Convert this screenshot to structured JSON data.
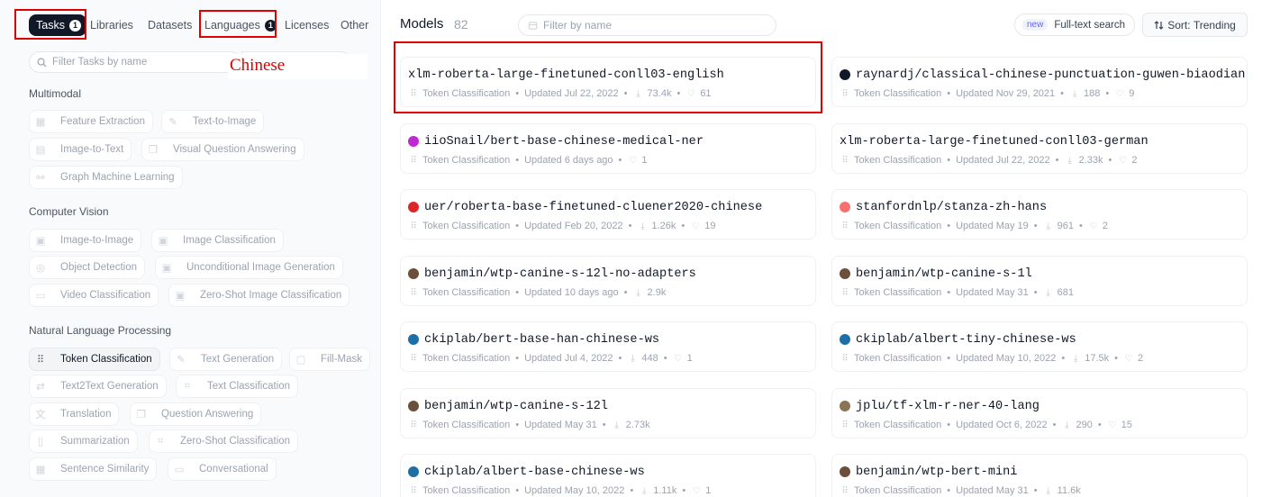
{
  "filter_tabs": [
    {
      "label": "Tasks",
      "badge": "1",
      "active": true
    },
    {
      "label": "Libraries"
    },
    {
      "label": "Datasets"
    },
    {
      "label": "Languages",
      "badge": "1"
    },
    {
      "label": "Licenses"
    },
    {
      "label": "Other"
    }
  ],
  "sidebar": {
    "search_placeholder": "Filter Tasks by name",
    "annotation": "Chinese",
    "sections": [
      {
        "title": "Multimodal",
        "chips": [
          {
            "label": "Feature Extraction",
            "icon": "table-icon"
          },
          {
            "label": "Text-to-Image",
            "icon": "brush-icon"
          },
          {
            "label": "Image-to-Text",
            "icon": "image-text-icon"
          },
          {
            "label": "Visual Question Answering",
            "icon": "qa-icon"
          },
          {
            "label": "Graph Machine Learning",
            "icon": "graph-icon"
          }
        ]
      },
      {
        "title": "Computer Vision",
        "chips": [
          {
            "label": "Image-to-Image",
            "icon": "image-icon"
          },
          {
            "label": "Image Classification",
            "icon": "image-icon"
          },
          {
            "label": "Object Detection",
            "icon": "detect-icon"
          },
          {
            "label": "Unconditional Image Generation",
            "icon": "image-icon"
          },
          {
            "label": "Video Classification",
            "icon": "video-icon"
          },
          {
            "label": "Zero-Shot Image Classification",
            "icon": "image-icon"
          }
        ]
      },
      {
        "title": "Natural Language Processing",
        "chips": [
          {
            "label": "Token Classification",
            "icon": "token-icon",
            "selected": true
          },
          {
            "label": "Text Generation",
            "icon": "pen-icon"
          },
          {
            "label": "Fill-Mask",
            "icon": "mask-icon"
          },
          {
            "label": "Text2Text Generation",
            "icon": "text2text-icon"
          },
          {
            "label": "Text Classification",
            "icon": "tags-icon"
          },
          {
            "label": "Translation",
            "icon": "translate-icon"
          },
          {
            "label": "Question Answering",
            "icon": "qa-icon"
          },
          {
            "label": "Summarization",
            "icon": "doc-icon"
          },
          {
            "label": "Zero-Shot Classification",
            "icon": "tags-icon"
          },
          {
            "label": "Sentence Similarity",
            "icon": "grid-icon"
          },
          {
            "label": "Conversational",
            "icon": "chat-icon"
          }
        ]
      }
    ]
  },
  "header": {
    "title": "Models",
    "count": "82",
    "filter_placeholder": "Filter by name",
    "fulltext_badge": "new",
    "fulltext_label": "Full-text search",
    "sort_label": "Sort:",
    "sort_value": "Trending"
  },
  "models": [
    {
      "name": "xlm-roberta-large-finetuned-conll03-english",
      "task": "Token Classification",
      "updated": "Updated Jul 22, 2022",
      "downloads": "73.4k",
      "likes": "61",
      "avatar": "none"
    },
    {
      "name": "raynardj/classical-chinese-punctuation-guwen-biaodian",
      "task": "Token Classification",
      "updated": "Updated Nov 29, 2021",
      "downloads": "188",
      "likes": "9",
      "avatar": "#111827"
    },
    {
      "name": "iioSnail/bert-base-chinese-medical-ner",
      "task": "Token Classification",
      "updated": "Updated 6 days ago",
      "downloads": "",
      "likes": "1",
      "avatar": "#c026d3"
    },
    {
      "name": "xlm-roberta-large-finetuned-conll03-german",
      "task": "Token Classification",
      "updated": "Updated Jul 22, 2022",
      "downloads": "2.33k",
      "likes": "2",
      "avatar": "none"
    },
    {
      "name": "uer/roberta-base-finetuned-cluener2020-chinese",
      "task": "Token Classification",
      "updated": "Updated Feb 20, 2022",
      "downloads": "1.26k",
      "likes": "19",
      "avatar": "#dc2626"
    },
    {
      "name": "stanfordnlp/stanza-zh-hans",
      "task": "Token Classification",
      "updated": "Updated May 19",
      "downloads": "961",
      "likes": "2",
      "avatar": "#f87171"
    },
    {
      "name": "benjamin/wtp-canine-s-12l-no-adapters",
      "task": "Token Classification",
      "updated": "Updated 10 days ago",
      "downloads": "2.9k",
      "likes": "",
      "avatar": "#6b4f3a"
    },
    {
      "name": "benjamin/wtp-canine-s-1l",
      "task": "Token Classification",
      "updated": "Updated May 31",
      "downloads": "681",
      "likes": "",
      "avatar": "#6b4f3a"
    },
    {
      "name": "ckiplab/bert-base-han-chinese-ws",
      "task": "Token Classification",
      "updated": "Updated Jul 4, 2022",
      "downloads": "448",
      "likes": "1",
      "avatar": "#1e6fa8"
    },
    {
      "name": "ckiplab/albert-tiny-chinese-ws",
      "task": "Token Classification",
      "updated": "Updated May 10, 2022",
      "downloads": "17.5k",
      "likes": "2",
      "avatar": "#1e6fa8"
    },
    {
      "name": "benjamin/wtp-canine-s-12l",
      "task": "Token Classification",
      "updated": "Updated May 31",
      "downloads": "2.73k",
      "likes": "",
      "avatar": "#6b4f3a"
    },
    {
      "name": "jplu/tf-xlm-r-ner-40-lang",
      "task": "Token Classification",
      "updated": "Updated Oct 6, 2022",
      "downloads": "290",
      "likes": "15",
      "avatar": "#8b7355"
    },
    {
      "name": "ckiplab/albert-base-chinese-ws",
      "task": "Token Classification",
      "updated": "Updated May 10, 2022",
      "downloads": "1.11k",
      "likes": "1",
      "avatar": "#1e6fa8"
    },
    {
      "name": "benjamin/wtp-bert-mini",
      "task": "Token Classification",
      "updated": "Updated May 31",
      "downloads": "11.6k",
      "likes": "",
      "avatar": "#6b4f3a"
    }
  ]
}
